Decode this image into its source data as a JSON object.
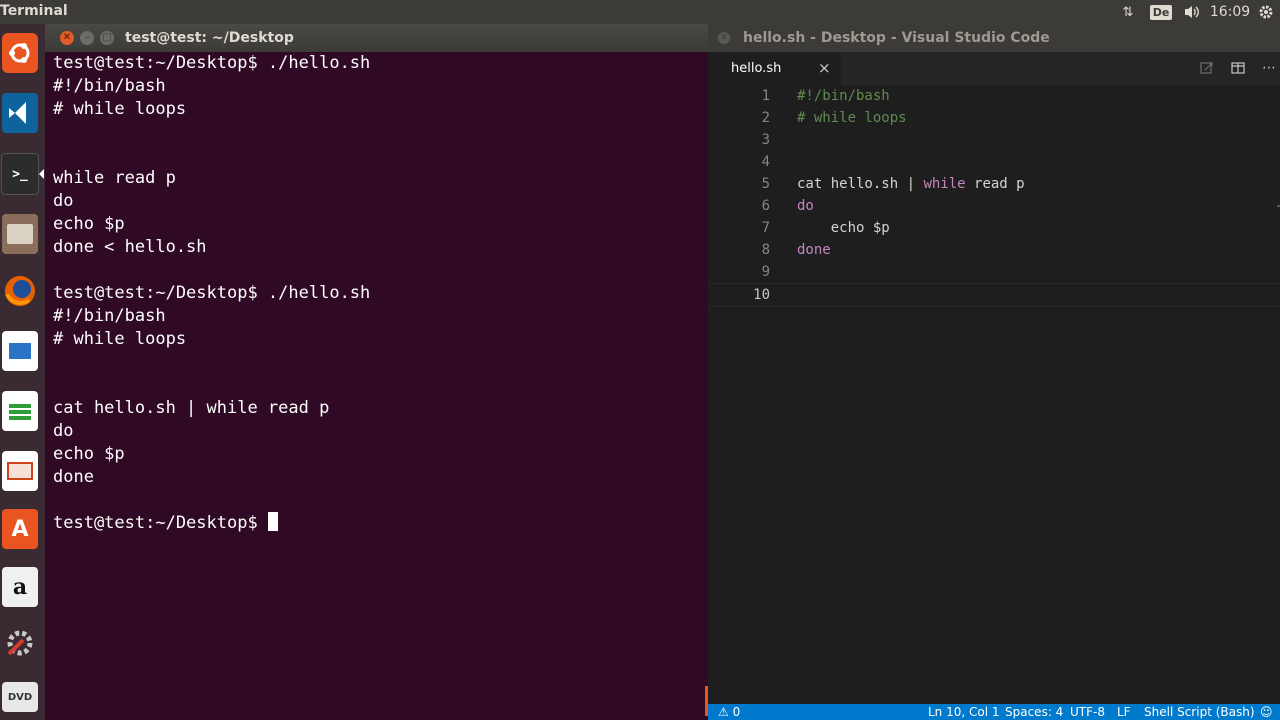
{
  "top_panel": {
    "app_name": "Terminal",
    "keyboard_layout": "De",
    "clock": "16:09",
    "icons": [
      "network-icon",
      "keyboard-layout-icon",
      "volume-icon",
      "settings-gear-icon"
    ]
  },
  "launcher": {
    "items": [
      "ubuntu-dash",
      "visual-studio-code",
      "terminal",
      "files",
      "firefox",
      "libreoffice-writer",
      "libreoffice-calc",
      "libreoffice-impress",
      "ubuntu-software-center",
      "amazon",
      "system-settings",
      "dvd"
    ]
  },
  "terminal": {
    "title": "test@test: ~/Desktop",
    "lines": [
      "test@test:~/Desktop$ ./hello.sh",
      "#!/bin/bash",
      "# while loops",
      "",
      "",
      "while read p",
      "do",
      "echo $p",
      "done < hello.sh",
      "",
      "test@test:~/Desktop$ ./hello.sh",
      "#!/bin/bash",
      "# while loops",
      "",
      "",
      "cat hello.sh | while read p",
      "do",
      "echo $p",
      "done",
      "",
      "test@test:~/Desktop$ "
    ]
  },
  "vscode": {
    "title": "hello.sh - Desktop - Visual Studio Code",
    "tab_label": "hello.sh",
    "tab_close": "×",
    "line_numbers": [
      "1",
      "2",
      "3",
      "4",
      "5",
      "6",
      "7",
      "8",
      "9",
      "10"
    ],
    "code": {
      "l1": "#!/bin/bash",
      "l2": "# while loops",
      "l5_a": "cat hello.sh | ",
      "l5_kw": "while",
      "l5_b": " read p",
      "l6": "do",
      "l7": "    echo $p",
      "l8": "done"
    },
    "status": {
      "problems": "⚠ 0",
      "position": "Ln 10, Col 1",
      "spaces": "Spaces: 4",
      "encoding": "UTF-8",
      "eol": "LF",
      "language": "Shell Script (Bash)",
      "feedback": "☺"
    }
  },
  "colors": {
    "terminal_bg": "#300a24",
    "editor_bg": "#1e1e1e",
    "statusbar_bg": "#007acc",
    "comment": "#608b4e",
    "keyword": "#c586c0"
  }
}
